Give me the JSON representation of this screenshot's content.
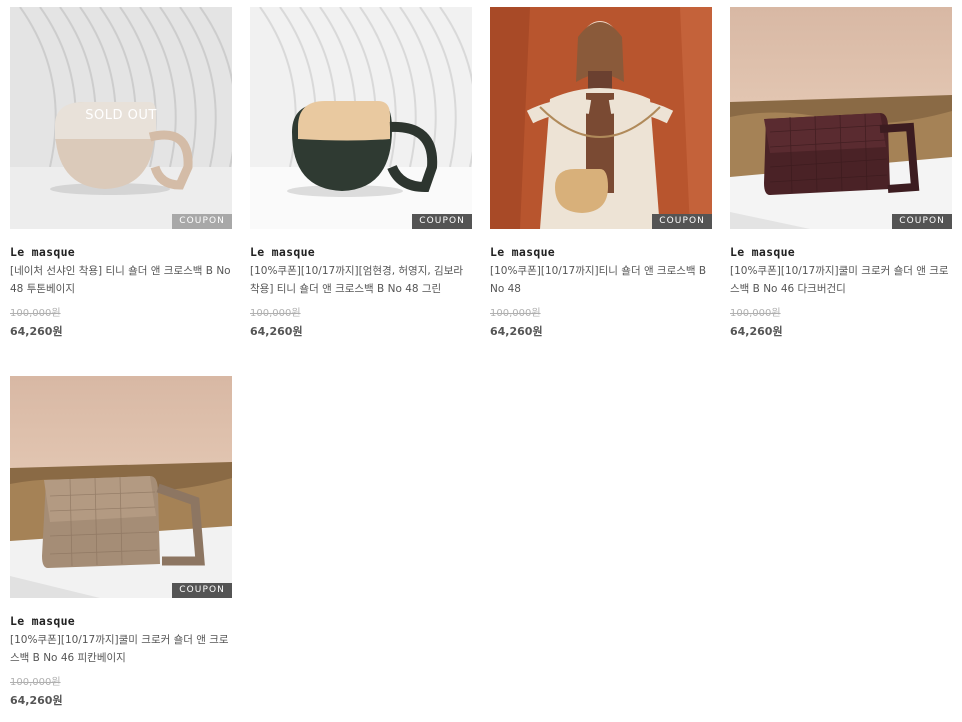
{
  "products": [
    {
      "brand": "Le masque",
      "name": "[네이처 선샤인 착용] 티니 숄더 앤 크로스백 B No 48 투톤베이지",
      "original_price": "100,000원",
      "sale_price": "64,260원",
      "badge": "COUPON",
      "overlay": "SOLD OUT"
    },
    {
      "brand": "Le masque",
      "name": "[10%쿠폰][10/17까지][엄현경, 허영지, 김보라 착용] 티니 숄더 앤 크로스백 B No 48 그린",
      "original_price": "100,000원",
      "sale_price": "64,260원",
      "badge": "COUPON"
    },
    {
      "brand": "Le masque",
      "name": "[10%쿠폰][10/17까지]티니 숄더 앤 크로스백 B No 48",
      "original_price": "100,000원",
      "sale_price": "64,260원",
      "badge": "COUPON"
    },
    {
      "brand": "Le masque",
      "name": "[10%쿠폰][10/17까지]쿨미 크로커 숄더 앤 크로스백 B No 46 다크버건디",
      "original_price": "100,000원",
      "sale_price": "64,260원",
      "badge": "COUPON"
    },
    {
      "brand": "Le masque",
      "name": "[10%쿠폰][10/17까지]쿨미 크로커 숄더 앤 크로스백 B No 46 피칸베이지",
      "original_price": "100,000원",
      "sale_price": "64,260원",
      "badge": "COUPON"
    }
  ],
  "image_palette": {
    "studio_backdrop": "#ececec",
    "beige_bag": "#e7d5c4",
    "green_bag": "#2f3a32",
    "tan_flap": "#e9c9a0",
    "orange_backdrop": "#b8552e",
    "burgundy_bag": "#4a2226",
    "pecan_bag": "#a58d76",
    "sky": "#e8cdb8"
  }
}
